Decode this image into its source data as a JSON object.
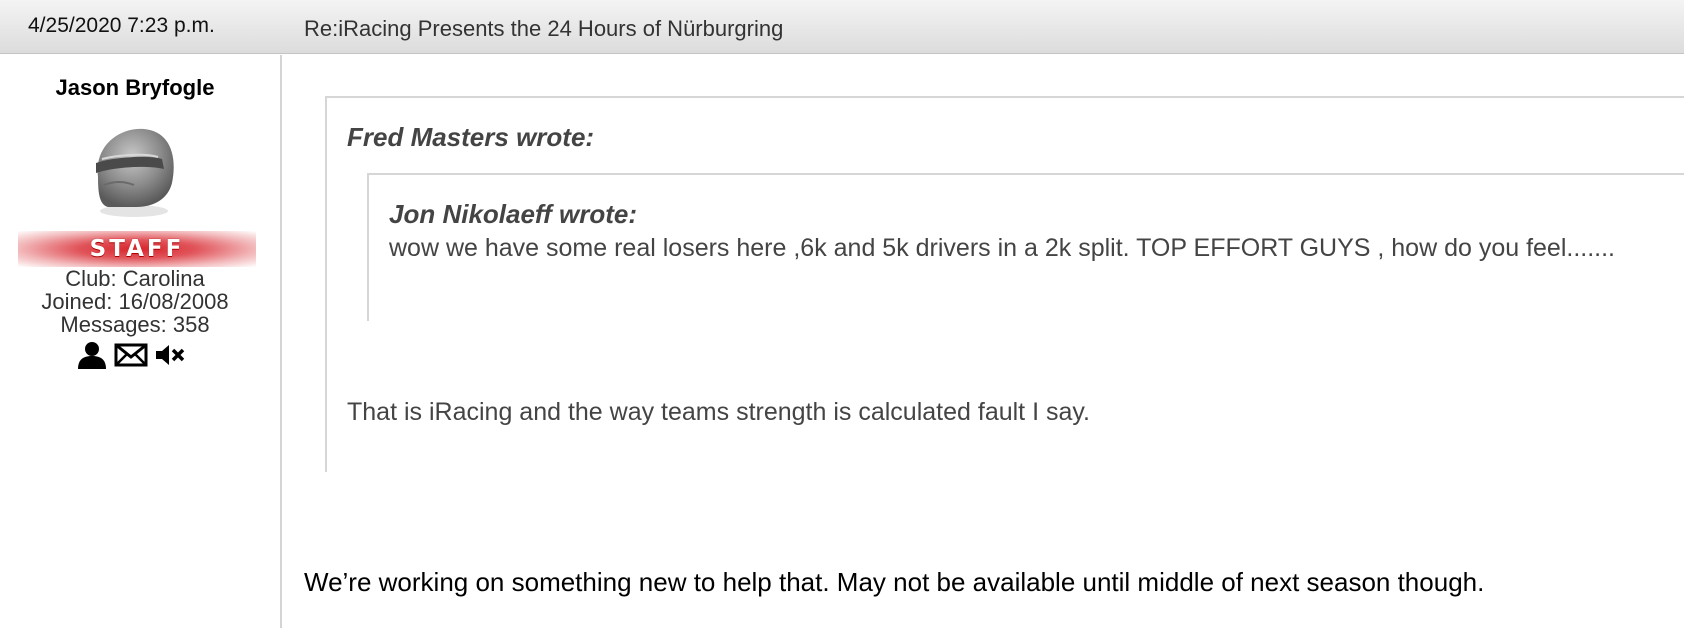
{
  "header": {
    "date": "4/25/2020 7:23 p.m.",
    "title": "Re:iRacing Presents the 24 Hours of Nürburgring"
  },
  "author": {
    "name": "Jason Bryfogle",
    "badge": "STAFF",
    "club": "Club: Carolina",
    "joined": "Joined: 16/08/2008",
    "messages": "Messages: 358",
    "icons": [
      "profile-icon",
      "envelope-icon",
      "mute-icon"
    ]
  },
  "post": {
    "outer_quote": {
      "header": "Fred Masters wrote:",
      "body": "That is iRacing and the way teams strength is calculated fault I say."
    },
    "inner_quote": {
      "header": "Jon Nikolaeff wrote:",
      "body": "wow we have some real losers here ,6k and 5k drivers in a 2k split. TOP EFFORT GUYS , how do you feel......."
    },
    "body": "We’re working on something new to help that. May not be available until middle of next season though."
  },
  "colors": {
    "header_bar": "#e6e6e6",
    "staff_badge": "#d8242b",
    "quote_border": "#d6d6d6",
    "quote_text": "#444444"
  }
}
